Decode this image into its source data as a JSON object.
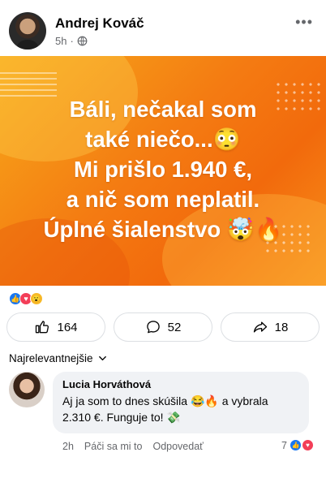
{
  "post": {
    "author": "Andrej Kováč",
    "time": "5h",
    "privacy_icon": "globe-icon",
    "more_label": "•••"
  },
  "banner": {
    "line1": "Báli, nečakal som",
    "line2": "také niečo...😳",
    "line3": "Mi prišlo 1.940 €,",
    "line4": "a nič som neplatil.",
    "line5": "Úplné šialenstvo 🤯🔥",
    "colors": {
      "primary": "#f47b12",
      "light": "#f7a91a"
    }
  },
  "reactions": {
    "icons": [
      "like-icon",
      "love-icon",
      "wow-icon"
    ],
    "like_glyph": "👍",
    "love_glyph": "♥",
    "wow_glyph": "😮"
  },
  "actions": {
    "likes": "164",
    "comments": "52",
    "shares": "18"
  },
  "comments_sort": {
    "label": "Najrelevantnejšie"
  },
  "comment": {
    "author": "Lucia Horváthová",
    "text_line1": "Aj ja som to dnes skúšila 😂🔥 a vybrala",
    "text_line2": "2.310 €. Funguje to! 💸",
    "time": "2h",
    "like_action": "Páči sa mi to",
    "reply_action": "Odpovedať",
    "reaction_count": "7"
  },
  "accent_color": "#1877f2"
}
